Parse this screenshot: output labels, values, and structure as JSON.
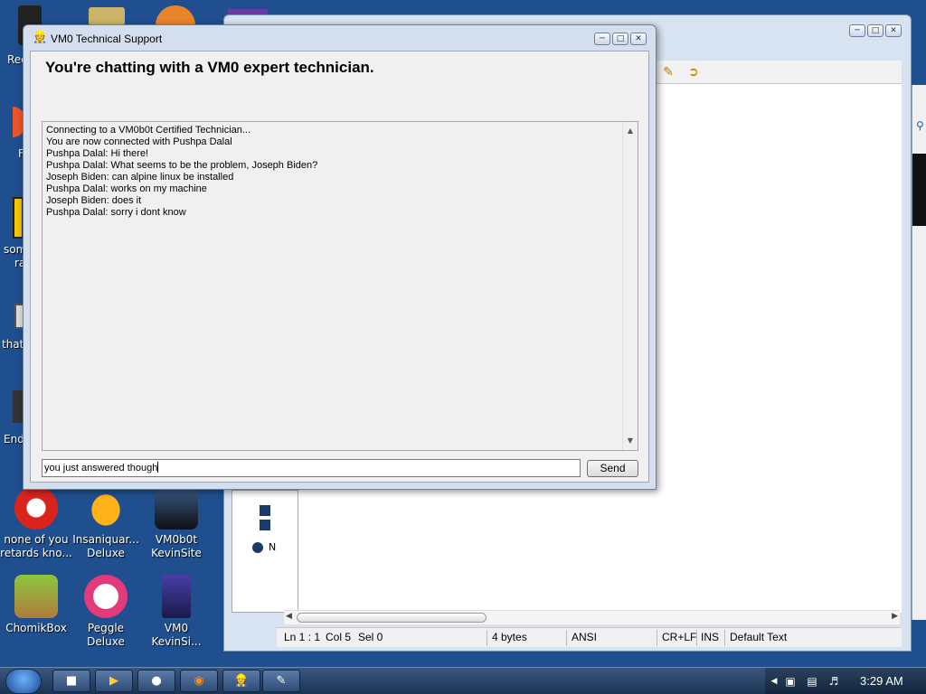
{
  "desktop": {
    "icons": [
      {
        "label": "none of you retards kno...",
        "icon": "red-bird-icon"
      },
      {
        "label": "Insaniquar... Deluxe",
        "icon": "fish-icon"
      },
      {
        "label": "VM0b0t KevinSite",
        "icon": "robot-icon"
      },
      {
        "label": "ChomikBox",
        "icon": "hamster-box-icon"
      },
      {
        "label": "Peggle Deluxe",
        "icon": "peggle-icon"
      },
      {
        "label": "VM0 KevinSi...",
        "icon": "firefox-file-icon"
      }
    ],
    "clipped_labels": [
      "Rec",
      "F",
      "som",
      "ra",
      "that",
      "End"
    ]
  },
  "editor": {
    "status": {
      "position": "Ln 1 : 1",
      "col": "Col 5",
      "sel": "Sel 0",
      "size": "4 bytes",
      "encoding": "ANSI",
      "line_ending": "CR+LF",
      "mode": "INS",
      "style": "Default Text"
    },
    "side_label": "N"
  },
  "chat": {
    "window_title": "VM0 Technical Support",
    "heading": "You're chatting with a VM0 expert technician.",
    "log": [
      "Connecting to a VM0b0t Certified Technician...",
      "You are now connected with Pushpa Dalal",
      "Pushpa Dalal: Hi there!",
      "Pushpa Dalal: What seems to be the problem, Joseph Biden?",
      "Joseph Biden: can alpine linux be installed",
      "Pushpa Dalal: works on my machine",
      "Joseph Biden: does it",
      "Pushpa Dalal: sorry i dont know"
    ],
    "input_value": "you just answered though",
    "send_label": "Send"
  },
  "taskbar": {
    "clock": "3:29 AM",
    "buttons": [
      "terminal",
      "media",
      "vm",
      "firefox",
      "support",
      "notepad"
    ]
  },
  "colors": {
    "desktop_bg": "#1f4f8f",
    "window_frame": "#d3dfee",
    "taskbar": "#2a4568"
  }
}
